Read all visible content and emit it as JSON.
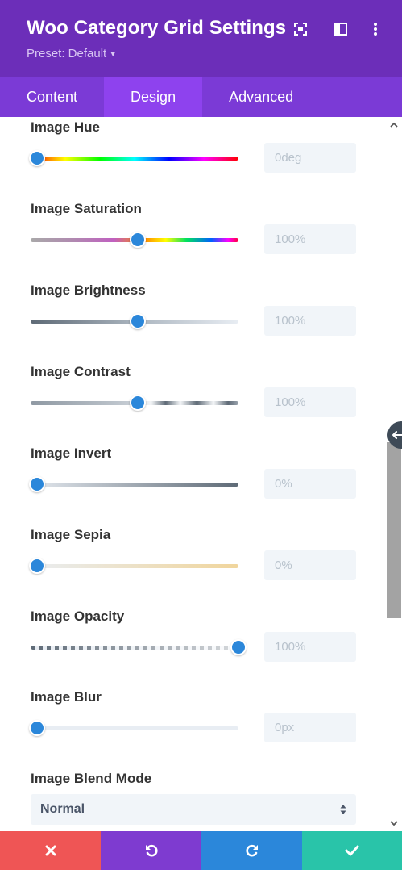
{
  "header": {
    "title": "Woo Category Grid Settings",
    "preset_label": "Preset: Default",
    "icons": [
      "focus-icon",
      "sidebar-toggle-icon",
      "more-options-icon"
    ],
    "background": "#6c2eb9"
  },
  "tabs": [
    {
      "label": "Content",
      "active": false
    },
    {
      "label": "Design",
      "active": true
    },
    {
      "label": "Advanced",
      "active": false
    }
  ],
  "settings": [
    {
      "label": "Image Hue",
      "value": "0deg",
      "level": 0.0
    },
    {
      "label": "Image Saturation",
      "value": "100%",
      "level": 0.5
    },
    {
      "label": "Image Brightness",
      "value": "100%",
      "level": 0.5
    },
    {
      "label": "Image Contrast",
      "value": "100%",
      "level": 0.5
    },
    {
      "label": "Image Invert",
      "value": "0%",
      "level": 0.0
    },
    {
      "label": "Image Sepia",
      "value": "0%",
      "level": 0.0
    },
    {
      "label": "Image Opacity",
      "value": "100%",
      "level": 1.0
    },
    {
      "label": "Image Blur",
      "value": "0px",
      "level": 0.0
    }
  ],
  "blend_mode": {
    "label": "Image Blend Mode",
    "selected": "Normal"
  },
  "footer": {
    "buttons": [
      {
        "name": "discard",
        "icon": "close-icon",
        "color": "#ef5555"
      },
      {
        "name": "undo",
        "icon": "undo-icon",
        "color": "#7e3bd0"
      },
      {
        "name": "redo",
        "icon": "redo-icon",
        "color": "#2b87da"
      },
      {
        "name": "save",
        "icon": "check-icon",
        "color": "#29c4a9"
      }
    ]
  },
  "colors": {
    "accent": "#2b87da",
    "tabs_bg": "#7b3ad6",
    "tab_active_bg": "#8e42ee"
  }
}
